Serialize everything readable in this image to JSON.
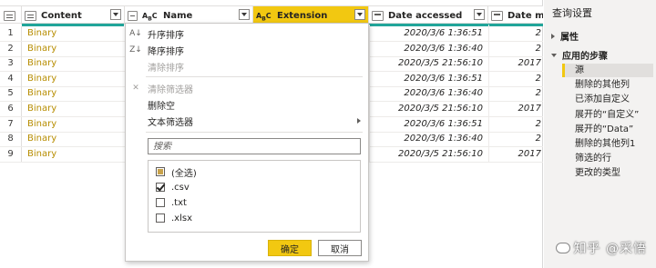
{
  "grid": {
    "columns": [
      {
        "label": "Content",
        "type_icon": "table-icon"
      },
      {
        "label": "Name",
        "type_icon": "abc-text-icon"
      },
      {
        "label": "Extension",
        "type_icon": "abc-text-icon"
      },
      {
        "label": "Date accessed",
        "type_icon": "calendar-icon"
      },
      {
        "label": "Date mod",
        "type_icon": "calendar-icon"
      }
    ],
    "rows": [
      {
        "n": "1",
        "content": "Binary",
        "accessed": "2020/3/6 1:36:51",
        "modified": "2"
      },
      {
        "n": "2",
        "content": "Binary",
        "accessed": "2020/3/6 1:36:40",
        "modified": "2"
      },
      {
        "n": "3",
        "content": "Binary",
        "accessed": "2020/3/5 21:56:10",
        "modified": "2017"
      },
      {
        "n": "4",
        "content": "Binary",
        "accessed": "2020/3/6 1:36:51",
        "modified": "2"
      },
      {
        "n": "5",
        "content": "Binary",
        "accessed": "2020/3/6 1:36:40",
        "modified": "2"
      },
      {
        "n": "6",
        "content": "Binary",
        "accessed": "2020/3/5 21:56:10",
        "modified": "2017"
      },
      {
        "n": "7",
        "content": "Binary",
        "accessed": "2020/3/6 1:36:51",
        "modified": "2"
      },
      {
        "n": "8",
        "content": "Binary",
        "accessed": "2020/3/6 1:36:40",
        "modified": "2"
      },
      {
        "n": "9",
        "content": "Binary",
        "accessed": "2020/3/5 21:56:10",
        "modified": "2017"
      }
    ]
  },
  "menu": {
    "sort_asc": "升序排序",
    "sort_desc": "降序排序",
    "clear_sort": "清除排序",
    "clear_filter": "清除筛选器",
    "remove_empty": "删除空",
    "text_filters": "文本筛选器",
    "search_placeholder": "搜索",
    "options": [
      {
        "label": "(全选)",
        "state": "partial"
      },
      {
        "label": ".csv",
        "state": "checked"
      },
      {
        "label": ".txt",
        "state": "unchecked"
      },
      {
        "label": ".xlsx",
        "state": "unchecked"
      }
    ],
    "ok_label": "确定",
    "cancel_label": "取消"
  },
  "pane": {
    "title": "查询设置",
    "properties_label": "属性",
    "applied_steps_label": "应用的步骤",
    "steps": [
      "源",
      "删除的其他列",
      "已添加自定义",
      "展开的“自定义”",
      "展开的“Data”",
      "删除的其他列1",
      "筛选的行",
      "更改的类型"
    ],
    "selected_step": "源"
  },
  "colors": {
    "accent_yellow": "#f2c811",
    "binary_text": "#b78d00",
    "quality_bar": "#21a59a"
  },
  "watermark": "知乎 @采悟"
}
